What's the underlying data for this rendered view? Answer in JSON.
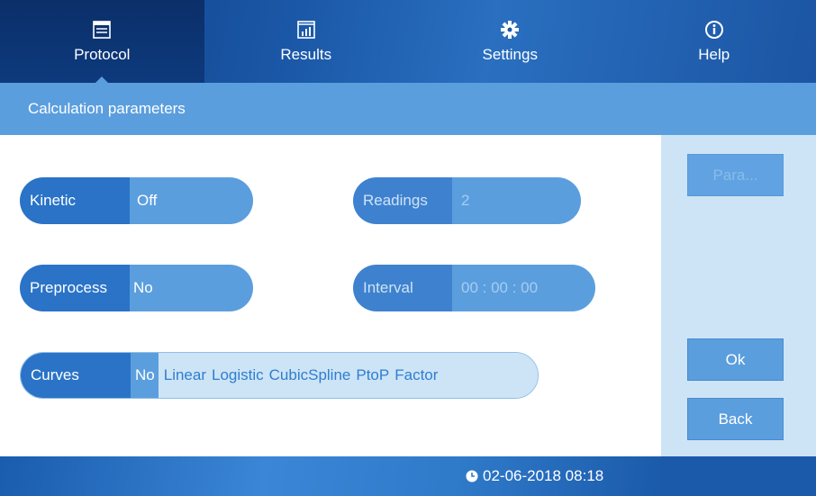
{
  "nav": {
    "tabs": [
      {
        "label": "Protocol",
        "icon": "document-window-icon",
        "active": true
      },
      {
        "label": "Results",
        "icon": "bar-chart-icon",
        "active": false
      },
      {
        "label": "Settings",
        "icon": "gear-icon",
        "active": false
      },
      {
        "label": "Help",
        "icon": "info-icon",
        "active": false
      }
    ]
  },
  "header": {
    "title": "Calculation parameters"
  },
  "params": {
    "kinetic": {
      "label": "Kinetic",
      "value": "Off"
    },
    "readings": {
      "label": "Readings",
      "value": "2"
    },
    "preprocess": {
      "label": "Preprocess",
      "value": "No"
    },
    "interval": {
      "label": "Interval",
      "value": "00 : 00 : 00"
    },
    "curves": {
      "label": "Curves",
      "options": [
        "No",
        "Linear",
        "Logistic",
        "CubicSpline",
        "PtoP",
        "Factor"
      ],
      "selected": "No"
    }
  },
  "side": {
    "para_label": "Para...",
    "ok_label": "Ok",
    "back_label": "Back"
  },
  "status": {
    "datetime": "02-06-2018 08:18"
  },
  "colors": {
    "accent": "#5b9ede",
    "dark": "#2a73c7",
    "nav": "#1a57a6",
    "panel": "#cde4f6"
  }
}
